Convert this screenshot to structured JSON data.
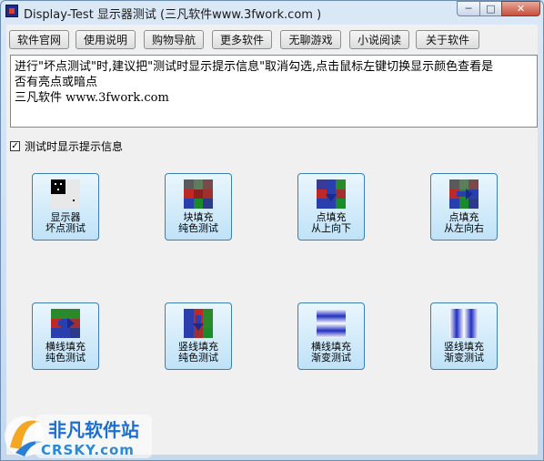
{
  "window": {
    "title": "Display-Test 显示器测试 (三凡软件www.3fwork.com )",
    "minimize": "─",
    "maximize": "□",
    "close": "✕"
  },
  "toolbar": [
    {
      "label": "软件官网"
    },
    {
      "label": "使用说明"
    },
    {
      "label": "购物导航"
    },
    {
      "label": "更多软件"
    },
    {
      "label": "无聊游戏"
    },
    {
      "label": "小说阅读"
    },
    {
      "label": "关于软件"
    }
  ],
  "info": {
    "line1": "进行\"坏点测试\"时,建议把\"测试时显示提示信息\"取消勾选,点击鼠标左键切换显示颜色查看是",
    "line2": "否有亮点或暗点",
    "line3": "三凡软件 www.3fwork.com"
  },
  "option": {
    "label": "测试时显示提示信息",
    "checked": true,
    "mark": "✓"
  },
  "tiles": [
    {
      "line1": "显示器",
      "line2": "坏点测试",
      "icon": "dead-pixel-icon"
    },
    {
      "line1": "块填充",
      "line2": "纯色测试",
      "icon": "block-fill-icon"
    },
    {
      "line1": "点填充",
      "line2": "从上向下",
      "icon": "top-down-fill-icon"
    },
    {
      "line1": "点填充",
      "line2": "从左向右",
      "icon": "left-right-fill-icon"
    },
    {
      "line1": "横线填充",
      "line2": "纯色测试",
      "icon": "horizontal-line-fill-icon"
    },
    {
      "line1": "竖线填充",
      "line2": "纯色测试",
      "icon": "vertical-line-fill-icon"
    },
    {
      "line1": "横线填充",
      "line2": "渐变测试",
      "icon": "horizontal-gradient-icon"
    },
    {
      "line1": "竖线填充",
      "line2": "渐变测试",
      "icon": "vertical-gradient-icon"
    }
  ],
  "watermark": {
    "cn": "非凡软件站",
    "en": "CRSKY.com"
  }
}
